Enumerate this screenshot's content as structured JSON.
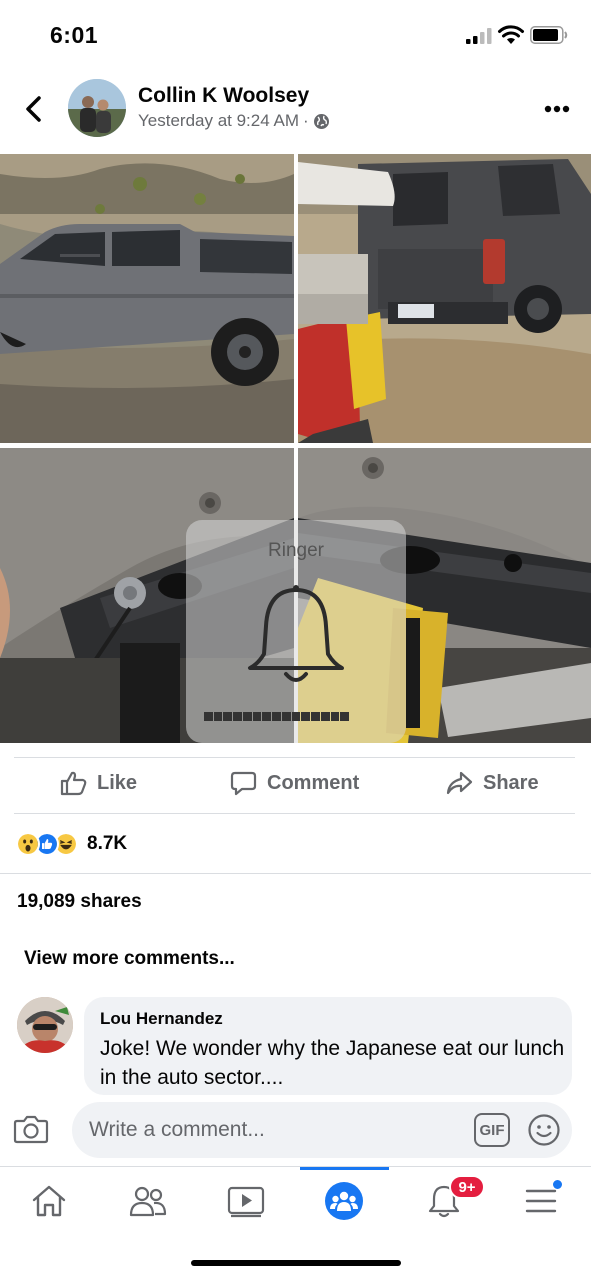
{
  "status_bar": {
    "time": "6:01"
  },
  "post": {
    "author": "Collin K Woolsey",
    "timestamp": "Yesterday at 9:24 AM",
    "privacy_icon": "globe-icon"
  },
  "ringer": {
    "title": "Ringer",
    "level": 0.79
  },
  "actions": {
    "like": "Like",
    "comment": "Comment",
    "share": "Share"
  },
  "reactions": {
    "icons": [
      "wow",
      "like",
      "haha"
    ],
    "count": "8.7K"
  },
  "shares_text": "19,089 shares",
  "view_more": "View more comments...",
  "comment": {
    "author": "Lou Hernandez",
    "text": "Joke!  We wonder why the Japanese eat our lunch in the auto sector...."
  },
  "composer": {
    "placeholder": "Write a comment...",
    "gif_label": "GIF"
  },
  "bottom_nav": {
    "items": [
      "home",
      "friends",
      "watch",
      "groups",
      "notifications",
      "menu"
    ],
    "active": "groups",
    "notifications_badge": "9+"
  },
  "colors": {
    "accent": "#1877f2",
    "badge": "#e41e3f",
    "secondary_text": "#65676b"
  }
}
